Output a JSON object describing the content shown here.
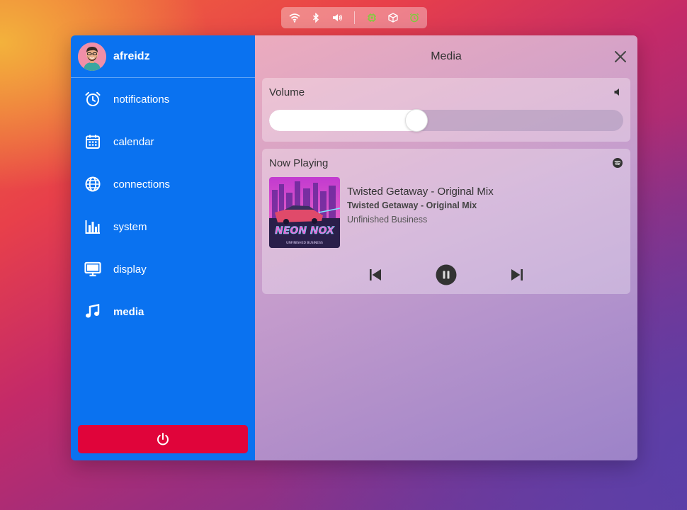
{
  "topbar": {
    "icons": [
      "wifi-icon",
      "bluetooth-icon",
      "volume-icon",
      "cpu-icon",
      "package-icon",
      "alarm-icon"
    ]
  },
  "user": {
    "name": "afreidz"
  },
  "sidebar": {
    "items": [
      {
        "label": "notifications",
        "icon": "alarm-clock-icon"
      },
      {
        "label": "calendar",
        "icon": "calendar-icon"
      },
      {
        "label": "connections",
        "icon": "globe-icon"
      },
      {
        "label": "system",
        "icon": "bar-chart-icon"
      },
      {
        "label": "display",
        "icon": "monitor-icon"
      },
      {
        "label": "media",
        "icon": "music-note-icon",
        "active": true
      }
    ],
    "power_icon": "power-icon"
  },
  "main": {
    "title": "Media",
    "volume": {
      "title": "Volume",
      "level_fraction": 0.416
    },
    "now_playing": {
      "title": "Now Playing",
      "track_title": "Twisted Getaway - Original Mix",
      "track_subtitle": "Twisted Getaway - Original Mix",
      "artist": "Unfinished Business",
      "album_art_text": "NEON NOX",
      "album_art_caption": "UNFINISHED BUSINESS",
      "controls": [
        "skip-previous-icon",
        "pause-icon",
        "skip-next-icon"
      ]
    }
  },
  "colors": {
    "sidebar": "#0a72f0",
    "power_button": "#e0043a",
    "status_green": "#7ccf3a"
  }
}
